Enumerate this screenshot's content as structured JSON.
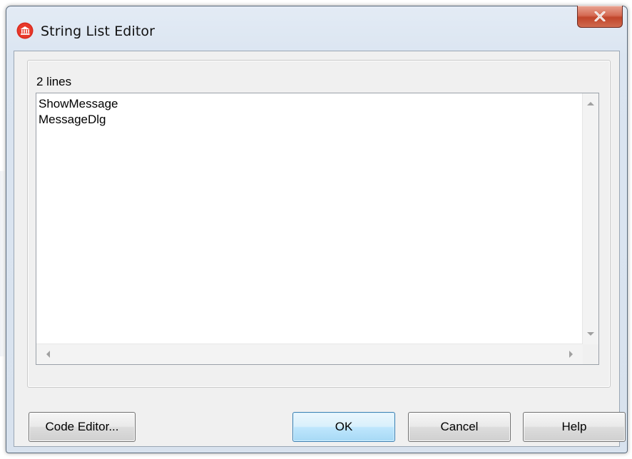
{
  "window": {
    "title": "String List Editor",
    "close_label": "X"
  },
  "editor": {
    "line_count_label": "2 lines",
    "lines": [
      "ShowMessage",
      "MessageDlg"
    ]
  },
  "buttons": {
    "code_editor": "Code Editor...",
    "ok": "OK",
    "cancel": "Cancel",
    "help": "Help"
  },
  "colors": {
    "ok_button_accent": "#3c7fb1",
    "close_button_red": "#c1452b",
    "icon_red": "#d9281c"
  }
}
